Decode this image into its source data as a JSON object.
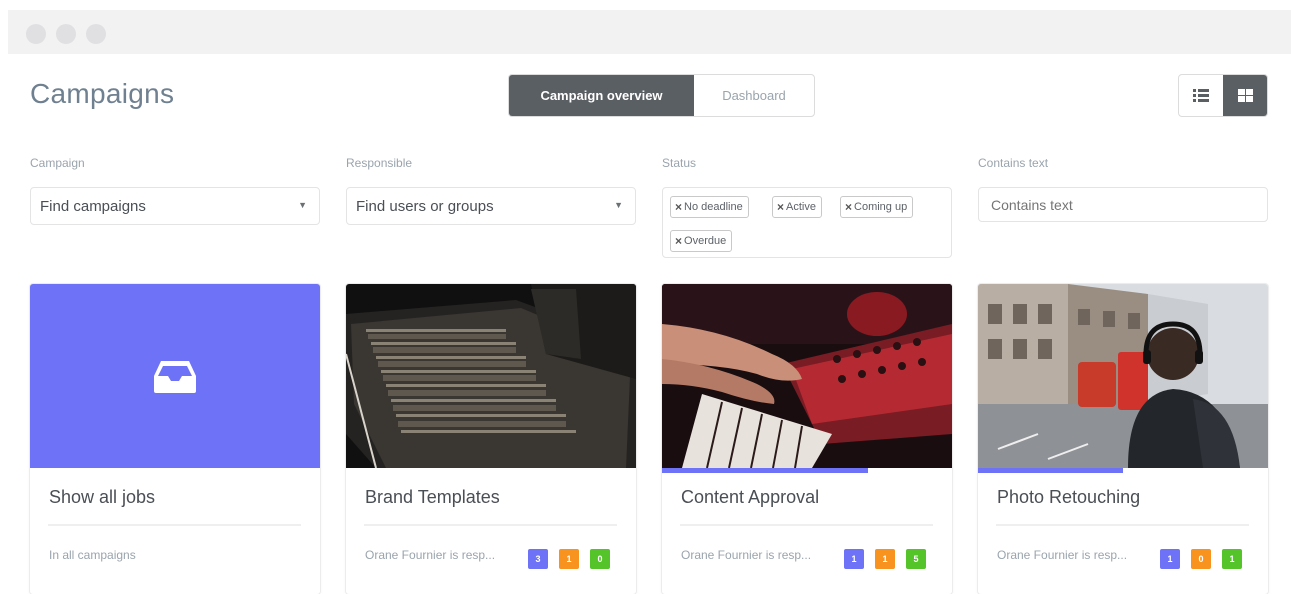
{
  "header": {
    "title": "Campaigns",
    "tabs": [
      {
        "label": "Campaign overview",
        "active": true
      },
      {
        "label": "Dashboard",
        "active": false
      }
    ],
    "view_switch": [
      "list-view-icon",
      "grid-view-icon"
    ]
  },
  "filters": {
    "campaign": {
      "label": "Campaign",
      "value": "Find campaigns"
    },
    "responsible": {
      "label": "Responsible",
      "value": "Find users or groups"
    },
    "status": {
      "label": "Status",
      "tags": [
        "No deadline",
        "Active",
        "Coming up",
        "Overdue"
      ]
    },
    "text": {
      "label": "Contains text",
      "placeholder": "Contains text"
    }
  },
  "cards": [
    {
      "title": "Show all jobs",
      "subtitle": "In all campaigns",
      "icon": "inbox-icon",
      "accent": "#6e72f7"
    },
    {
      "title": "Brand Templates",
      "subtitle": "Orane Fournier is resp...",
      "badges": [
        "3",
        "1",
        "0"
      ],
      "progress": 0
    },
    {
      "title": "Content Approval",
      "subtitle": "Orane Fournier is resp...",
      "badges": [
        "1",
        "1",
        "5"
      ],
      "progress": 0.71
    },
    {
      "title": "Photo Retouching",
      "subtitle": "Orane Fournier is resp...",
      "badges": [
        "1",
        "0",
        "1"
      ],
      "progress": 0.5
    }
  ],
  "badge_colors": [
    "#6e72f7",
    "#f7931e",
    "#54c42a"
  ]
}
